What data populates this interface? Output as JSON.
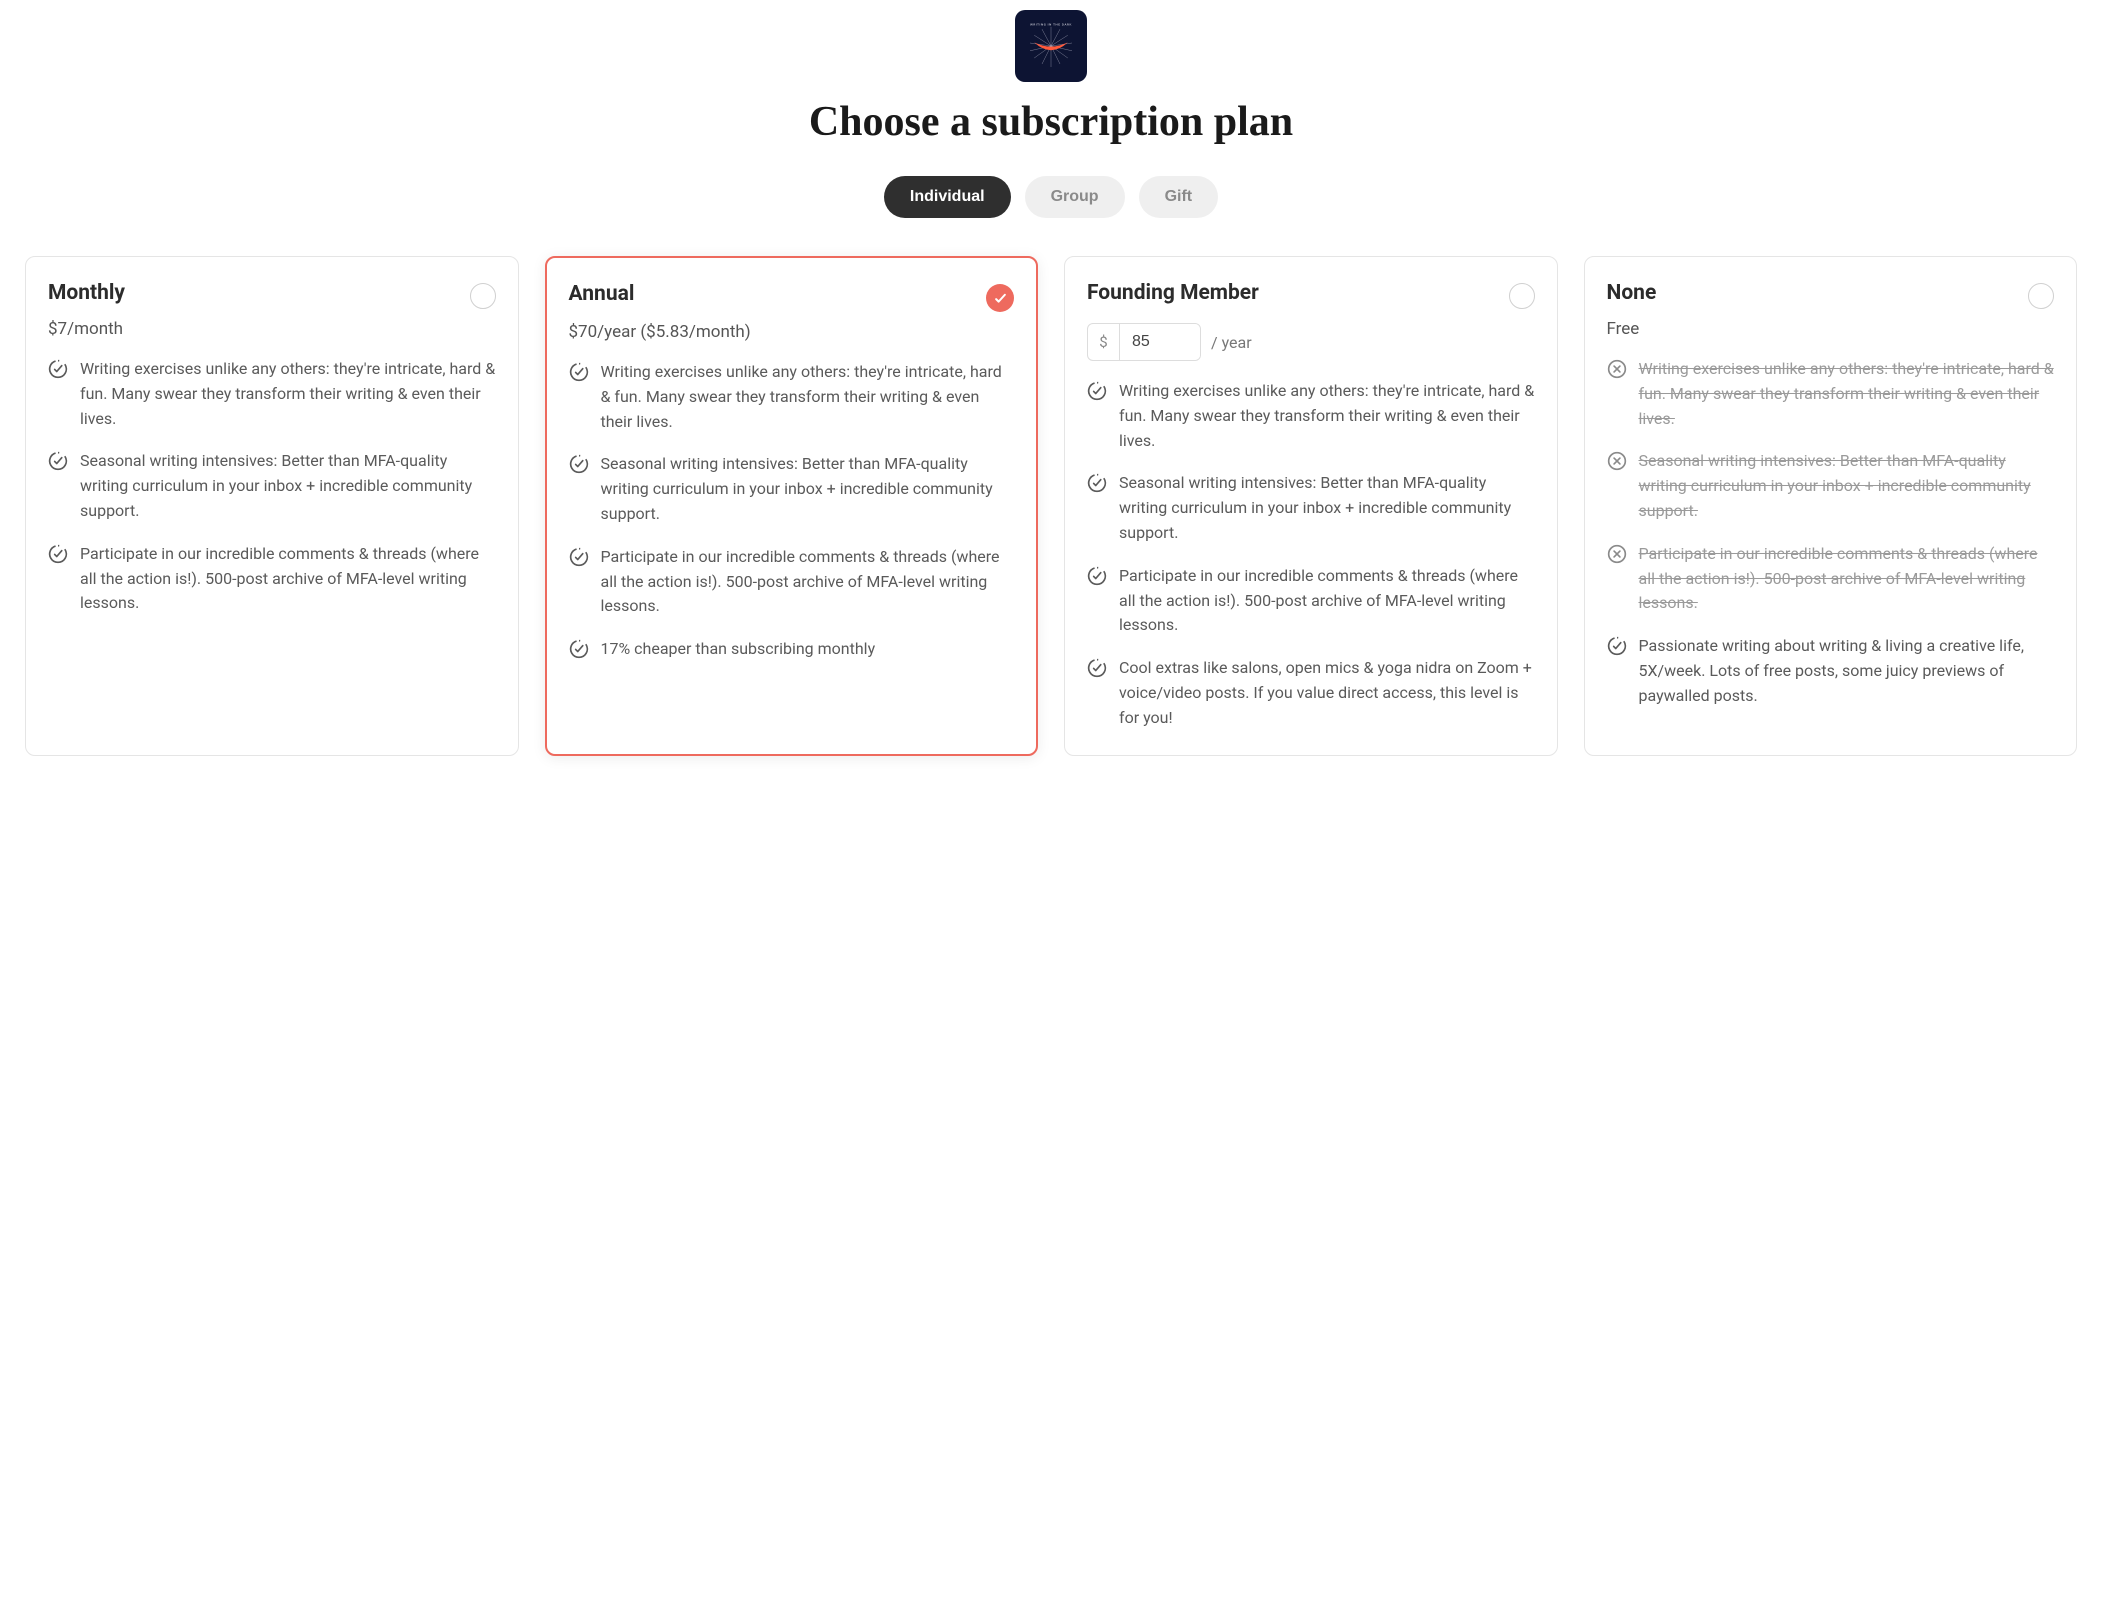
{
  "logo_alt": "Writing in the Dark",
  "heading": "Choose a subscription plan",
  "tabs": [
    {
      "label": "Individual",
      "active": true
    },
    {
      "label": "Group",
      "active": false
    },
    {
      "label": "Gift",
      "active": false
    }
  ],
  "plans": {
    "monthly": {
      "title": "Monthly",
      "price": "$7/month",
      "selected": false,
      "features": [
        {
          "text": "Writing exercises unlike any others: they're intricate, hard & fun. Many swear they transform their writing & even their lives.",
          "included": true
        },
        {
          "text": "Seasonal writing intensives: Better than MFA-quality writing curriculum in your inbox + incredible community support.",
          "included": true
        },
        {
          "text": "Participate in our incredible comments & threads (where all the action is!). 500-post archive of MFA-level writing lessons.",
          "included": true
        }
      ]
    },
    "annual": {
      "title": "Annual",
      "price": "$70/year ($5.83/month)",
      "selected": true,
      "features": [
        {
          "text": "Writing exercises unlike any others: they're intricate, hard & fun. Many swear they transform their writing & even their lives.",
          "included": true
        },
        {
          "text": "Seasonal writing intensives: Better than MFA-quality writing curriculum in your inbox + incredible community support.",
          "included": true
        },
        {
          "text": "Participate in our incredible comments & threads (where all the action is!). 500-post archive of MFA-level writing lessons.",
          "included": true
        },
        {
          "text": "17% cheaper than subscribing monthly",
          "included": true
        }
      ]
    },
    "founding": {
      "title": "Founding Member",
      "currency": "$",
      "amount": "85",
      "per": "/ year",
      "selected": false,
      "features": [
        {
          "text": "Writing exercises unlike any others: they're intricate, hard & fun. Many swear they transform their writing & even their lives.",
          "included": true
        },
        {
          "text": "Seasonal writing intensives: Better than MFA-quality writing curriculum in your inbox + incredible community support.",
          "included": true
        },
        {
          "text": "Participate in our incredible comments & threads (where all the action is!). 500-post archive of MFA-level writing lessons.",
          "included": true
        },
        {
          "text": "Cool extras like salons, open mics & yoga nidra on Zoom + voice/video posts. If you value direct access, this level is for you!",
          "included": true
        }
      ]
    },
    "none": {
      "title": "None",
      "price": "Free",
      "selected": false,
      "features": [
        {
          "text": "Writing exercises unlike any others: they're intricate, hard & fun. Many swear they transform their writing & even their lives.",
          "included": false
        },
        {
          "text": "Seasonal writing intensives: Better than MFA-quality writing curriculum in your inbox + incredible community support.",
          "included": false
        },
        {
          "text": "Participate in our incredible comments & threads (where all the action is!). 500-post archive of MFA-level writing lessons.",
          "included": false
        },
        {
          "text": "Passionate writing about writing & living a creative life, 5X/week. Lots of free posts, some juicy previews of paywalled posts.",
          "included": true
        }
      ]
    }
  }
}
